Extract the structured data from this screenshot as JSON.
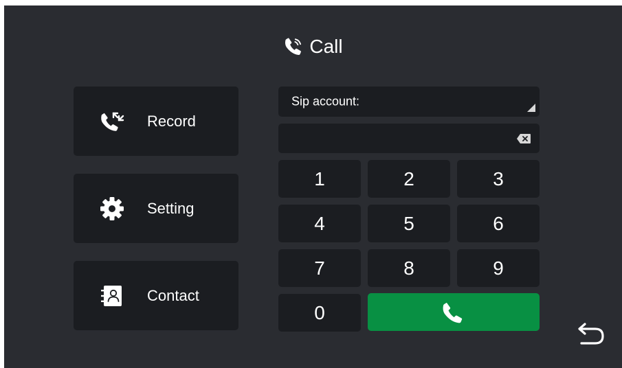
{
  "header": {
    "title": "Call",
    "title_icon": "phone-ringing-icon"
  },
  "menu": {
    "items": [
      {
        "label": "Record",
        "icon": "call-record-icon"
      },
      {
        "label": "Setting",
        "icon": "gear-icon"
      },
      {
        "label": "Contact",
        "icon": "contact-book-icon"
      }
    ]
  },
  "sip": {
    "label": "Sip account:",
    "icon": "dropdown-triangle-icon"
  },
  "number_input": {
    "value": "",
    "icon": "backspace-icon"
  },
  "keypad": {
    "keys": [
      "1",
      "2",
      "3",
      "4",
      "5",
      "6",
      "7",
      "8",
      "9",
      "0"
    ]
  },
  "call_button": {
    "icon": "phone-icon"
  },
  "back_button": {
    "icon": "back-arrow-icon"
  },
  "colors": {
    "background": "#2a2c31",
    "card": "#1b1d21",
    "call_green": "#089043",
    "text": "#ffffff"
  }
}
